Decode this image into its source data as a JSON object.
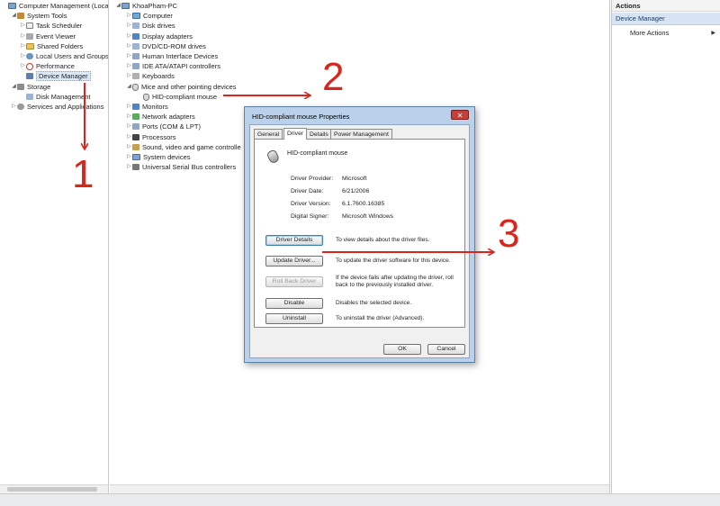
{
  "left_tree": {
    "items": [
      {
        "label": "Computer Management (Local",
        "indent": 0,
        "twisty": "",
        "icon": "computer-icon"
      },
      {
        "label": "System Tools",
        "indent": 1,
        "twisty": "◢",
        "icon": "tools-icon"
      },
      {
        "label": "Task Scheduler",
        "indent": 2,
        "twisty": "▷",
        "icon": "task-scheduler-icon"
      },
      {
        "label": "Event Viewer",
        "indent": 2,
        "twisty": "▷",
        "icon": "event-viewer-icon"
      },
      {
        "label": "Shared Folders",
        "indent": 2,
        "twisty": "▷",
        "icon": "shared-folders-icon"
      },
      {
        "label": "Local Users and Groups",
        "indent": 2,
        "twisty": "▷",
        "icon": "users-icon"
      },
      {
        "label": "Performance",
        "indent": 2,
        "twisty": "▷",
        "icon": "performance-icon"
      },
      {
        "label": "Device Manager",
        "indent": 2,
        "twisty": "",
        "icon": "device-manager-icon",
        "selected": true
      },
      {
        "label": "Storage",
        "indent": 1,
        "twisty": "◢",
        "icon": "storage-icon"
      },
      {
        "label": "Disk Management",
        "indent": 2,
        "twisty": "",
        "icon": "disk-icon"
      },
      {
        "label": "Services and Applications",
        "indent": 1,
        "twisty": "▷",
        "icon": "services-icon"
      }
    ]
  },
  "device_tree": {
    "items": [
      {
        "label": "KhoaPham-PC",
        "indent": 0,
        "twisty": "◢",
        "icon": "computer-icon"
      },
      {
        "label": "Computer",
        "indent": 1,
        "twisty": "▷",
        "icon": "computer-icon"
      },
      {
        "label": "Disk drives",
        "indent": 1,
        "twisty": "▷",
        "icon": "disk-icon"
      },
      {
        "label": "Display adapters",
        "indent": 1,
        "twisty": "▷",
        "icon": "display-icon"
      },
      {
        "label": "DVD/CD-ROM drives",
        "indent": 1,
        "twisty": "▷",
        "icon": "dvd-icon"
      },
      {
        "label": "Human Interface Devices",
        "indent": 1,
        "twisty": "▷",
        "icon": "hid-icon"
      },
      {
        "label": "IDE ATA/ATAPI controllers",
        "indent": 1,
        "twisty": "▷",
        "icon": "ide-icon"
      },
      {
        "label": "Keyboards",
        "indent": 1,
        "twisty": "▷",
        "icon": "keyboard-icon"
      },
      {
        "label": "Mice and other pointing devices",
        "indent": 1,
        "twisty": "◢",
        "icon": "mouse-icon"
      },
      {
        "label": "HID-compliant mouse",
        "indent": 2,
        "twisty": "",
        "icon": "mouse-icon"
      },
      {
        "label": "Monitors",
        "indent": 1,
        "twisty": "▷",
        "icon": "monitor-icon"
      },
      {
        "label": "Network adapters",
        "indent": 1,
        "twisty": "▷",
        "icon": "network-icon"
      },
      {
        "label": "Ports (COM & LPT)",
        "indent": 1,
        "twisty": "▷",
        "icon": "ports-icon"
      },
      {
        "label": "Processors",
        "indent": 1,
        "twisty": "▷",
        "icon": "processor-icon"
      },
      {
        "label": "Sound, video and game controlle",
        "indent": 1,
        "twisty": "▷",
        "icon": "sound-icon"
      },
      {
        "label": "System devices",
        "indent": 1,
        "twisty": "▷",
        "icon": "system-devices-icon"
      },
      {
        "label": "Universal Serial Bus controllers",
        "indent": 1,
        "twisty": "▷",
        "icon": "usb-icon"
      }
    ]
  },
  "actions": {
    "header": "Actions",
    "section": "Device Manager",
    "more": "More Actions",
    "arrow": "▶"
  },
  "dialog": {
    "title": "HID-compliant mouse Properties",
    "close_glyph": "✕",
    "tabs": [
      "General",
      "Driver",
      "Details",
      "Power Management"
    ],
    "active_tab": "Driver",
    "device_name": "HID-compliant mouse",
    "properties": [
      {
        "label": "Driver Provider:",
        "value": "Microsoft"
      },
      {
        "label": "Driver Date:",
        "value": "6/21/2006"
      },
      {
        "label": "Driver Version:",
        "value": "6.1.7600.16385"
      },
      {
        "label": "Digital Signer:",
        "value": "Microsoft Windows"
      }
    ],
    "buttons": [
      {
        "label": "Driver Details",
        "desc": "To view details about the driver files."
      },
      {
        "label": "Update Driver...",
        "desc": "To update the driver software for this device."
      },
      {
        "label": "Roll Back Driver",
        "desc": "If the device fails after updating the driver, roll back to the previously installed driver."
      },
      {
        "label": "Disable",
        "desc": "Disables the selected device."
      },
      {
        "label": "Uninstall",
        "desc": "To uninstall the driver (Advanced)."
      }
    ],
    "ok": "OK",
    "cancel": "Cancel"
  },
  "annotations": {
    "step1": "1",
    "step2": "2",
    "step3": "3",
    "color": "#d9261c"
  }
}
